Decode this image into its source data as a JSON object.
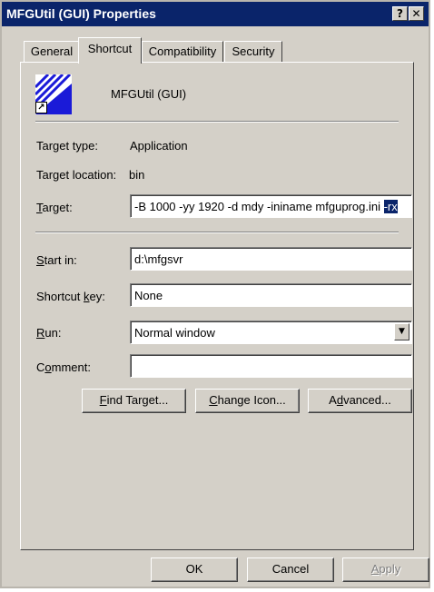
{
  "window": {
    "title": "MFGUtil (GUI) Properties",
    "help_glyph": "?",
    "close_glyph": "✕"
  },
  "tabs": [
    {
      "label": "General",
      "active": false
    },
    {
      "label": "Shortcut",
      "active": true
    },
    {
      "label": "Compatibility",
      "active": false
    },
    {
      "label": "Security",
      "active": false
    }
  ],
  "shortcut": {
    "app_name": "MFGUtil (GUI)",
    "shortcut_overlay_glyph": "↗",
    "target_type": {
      "label": "Target type:",
      "value": "Application"
    },
    "target_location": {
      "label": "Target location:",
      "value": "bin"
    },
    "target": {
      "label_accel": "T",
      "label_rest": "arget:",
      "value_unselected": "-B 1000 -yy 1920 -d mdy -ininame mfguprog.ini ",
      "value_selected": "-rx"
    },
    "start_in": {
      "label_accel": "S",
      "label_rest": "tart in:",
      "value": "d:\\mfgsvr"
    },
    "shortcut_key": {
      "label_pre": "Shortcut ",
      "label_accel": "k",
      "label_post": "ey:",
      "value": "None"
    },
    "run": {
      "label_accel": "R",
      "label_rest": "un:",
      "value": "Normal window",
      "arrow": "▼"
    },
    "comment": {
      "label_pre": "C",
      "label_accel": "o",
      "label_post": "mment:",
      "value": ""
    },
    "buttons": {
      "find_target": {
        "accel": "F",
        "rest": "ind Target..."
      },
      "change_icon": {
        "accel": "C",
        "rest": "hange Icon..."
      },
      "advanced": {
        "pre": "A",
        "accel": "d",
        "post": "vanced..."
      }
    }
  },
  "footer": {
    "ok": "OK",
    "cancel": "Cancel",
    "apply_accel": "A",
    "apply_rest": "pply",
    "apply_enabled": false
  },
  "colors": {
    "titlebar": "#0a246a",
    "face": "#d4d0c8",
    "icon_blue": "#1a1ad8"
  }
}
